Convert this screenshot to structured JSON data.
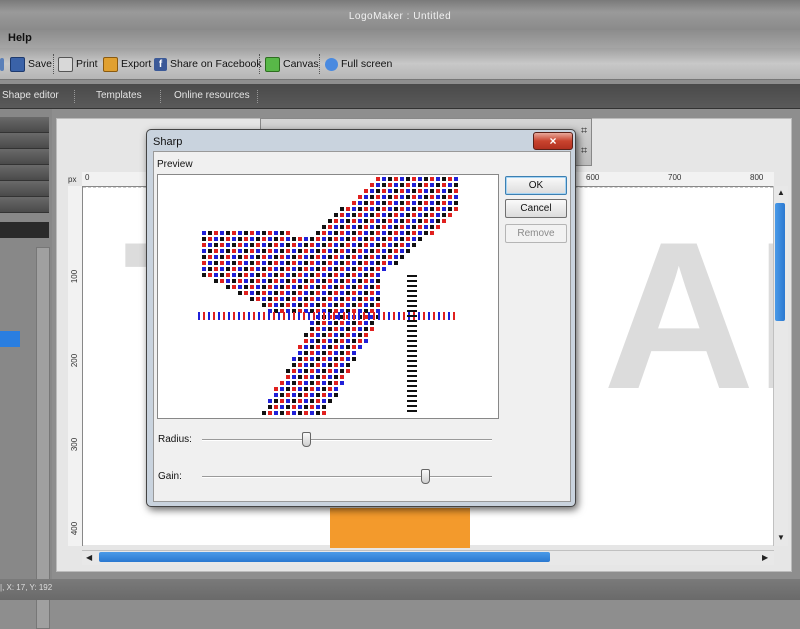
{
  "window": {
    "title": "LogoMaker : Untitled"
  },
  "menu": {
    "items": [
      "Help"
    ]
  },
  "toolbar": {
    "buttons": [
      {
        "label": "Save",
        "icon": "save-icon"
      },
      {
        "label": "Print",
        "icon": "printer-icon"
      },
      {
        "label": "Export",
        "icon": "export-icon"
      },
      {
        "label": "Share on Facebook",
        "icon": "facebook-icon"
      },
      {
        "label": "Canvas",
        "icon": "canvas-icon"
      },
      {
        "label": "Full screen",
        "icon": "fullscreen-icon"
      }
    ]
  },
  "tabs": [
    {
      "label": "Shape editor"
    },
    {
      "label": "Templates"
    },
    {
      "label": "Online resources"
    }
  ],
  "ruler": {
    "unit": "px",
    "top_ticks": [
      "0",
      "600",
      "700",
      "800"
    ],
    "left_ticks": [
      "100",
      "200",
      "300",
      "400"
    ]
  },
  "status": {
    "text": "|, X: 17, Y: 192"
  },
  "dialog": {
    "title": "Sharp",
    "close_label": "×",
    "preview_label": "Preview",
    "buttons": {
      "ok": "OK",
      "cancel": "Cancel",
      "remove": "Remove"
    },
    "sliders": [
      {
        "label": "Radius:",
        "value": 0.36
      },
      {
        "label": "Gain:",
        "value": 0.77
      }
    ]
  },
  "colors": {
    "accent_blue": "#2a78d0",
    "canvas_orange": "#f39a2c",
    "close_red": "#c8432e",
    "pixel_red": "#e0201e",
    "pixel_blue": "#2020d8"
  }
}
